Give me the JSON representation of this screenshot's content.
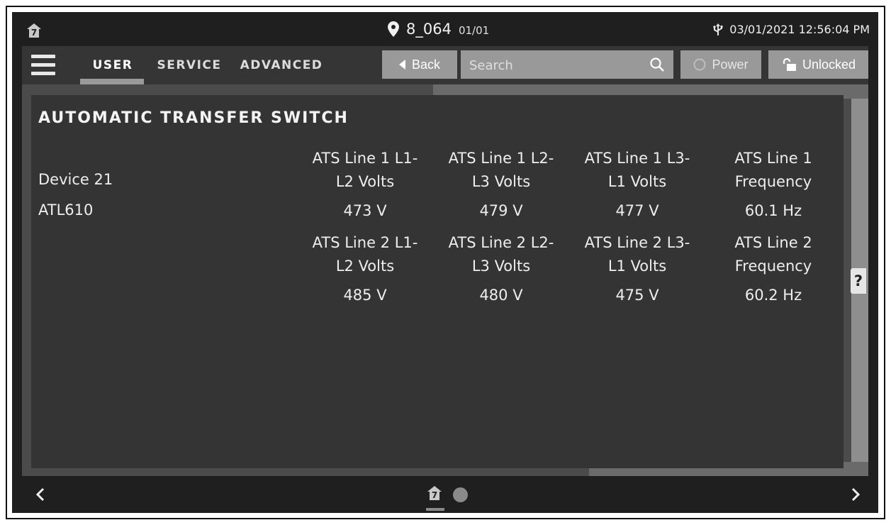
{
  "status": {
    "logo": "home-logo",
    "logo_glyph": "7",
    "location_icon": "map-pin-icon",
    "site": "8_064",
    "page": "01/01",
    "usb_icon": "usb-icon",
    "datetime": "03/01/2021 12:56:04 PM"
  },
  "toolbar": {
    "menu_icon": "hamburger-menu-icon",
    "tabs": [
      {
        "label": "USER",
        "active": true
      },
      {
        "label": "SERVICE",
        "active": false
      },
      {
        "label": "ADVANCED",
        "active": false
      }
    ],
    "back_label": "Back",
    "search_placeholder": "Search",
    "search_value": "",
    "power_label": "Power",
    "power_enabled": false,
    "lock_label": "Unlocked"
  },
  "panel": {
    "title": "AUTOMATIC TRANSFER SWITCH",
    "device_name": "Device 21",
    "device_model": "ATL610",
    "line1": {
      "headers": [
        [
          "ATS Line 1 L1-",
          "L2 Volts"
        ],
        [
          "ATS Line 1 L2-",
          "L3 Volts"
        ],
        [
          "ATS Line 1 L3-",
          "L1 Volts"
        ],
        [
          "ATS Line 1",
          "Frequency"
        ]
      ],
      "values": [
        "473 V",
        "479 V",
        "477 V",
        "60.1 Hz"
      ]
    },
    "line2": {
      "headers": [
        [
          "ATS Line 2 L1-",
          "L2 Volts"
        ],
        [
          "ATS Line 2 L2-",
          "L3 Volts"
        ],
        [
          "ATS Line 2 L3-",
          "L1 Volts"
        ],
        [
          "ATS Line 2",
          "Frequency"
        ]
      ],
      "values": [
        "485 V",
        "480 V",
        "475 V",
        "60.2 Hz"
      ]
    },
    "help_label": "?"
  },
  "bottom": {
    "prev_icon": "chevron-left-icon",
    "next_icon": "chevron-right-icon",
    "pages": [
      {
        "icon": "home-logo",
        "glyph": "7",
        "active": true
      },
      {
        "icon": "page-dot",
        "active": false
      }
    ]
  },
  "colors": {
    "background": "#1f1f1f",
    "toolbar": "#353535",
    "panel": "#343434",
    "button": "#999999"
  }
}
